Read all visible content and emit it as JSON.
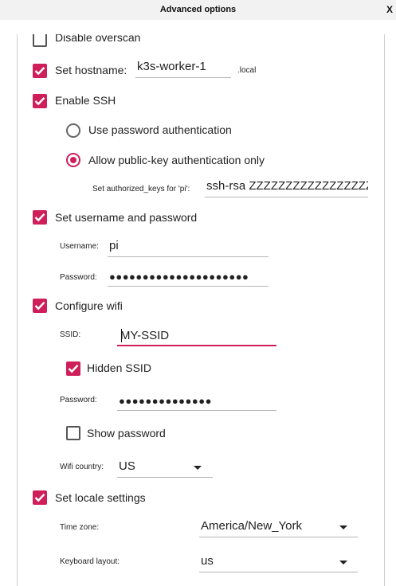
{
  "window": {
    "title": "Advanced options",
    "close_label": "X"
  },
  "colors": {
    "accent": "#cf1f5a"
  },
  "options": {
    "disable_overscan": {
      "label": "Disable overscan",
      "checked": false
    },
    "hostname": {
      "label": "Set hostname:",
      "value": "k3s-worker-1",
      "suffix": ".local",
      "checked": true
    },
    "ssh": {
      "label": "Enable SSH",
      "checked": true,
      "password_auth_label": "Use password authentication",
      "pubkey_auth_label": "Allow public-key authentication only",
      "selected": "pubkey",
      "authorized_keys_label": "Set authorized_keys for 'pi':",
      "authorized_keys_value": "ssh-rsa ZZZZZZZZZZZZZZZZZZZZ"
    },
    "user": {
      "label": "Set username and password",
      "checked": true,
      "username_label": "Username:",
      "username_value": "pi",
      "password_label": "Password:",
      "password_value": "●●●●●●●●●●●●●●●●●●●●●"
    },
    "wifi": {
      "label": "Configure wifi",
      "checked": true,
      "ssid_label": "SSID:",
      "ssid_value": "MY-SSID",
      "hidden_ssid_label": "Hidden SSID",
      "hidden_ssid_checked": true,
      "password_label": "Password:",
      "password_value": "●●●●●●●●●●●●●●",
      "show_password_label": "Show password",
      "show_password_checked": false,
      "country_label": "Wifi country:",
      "country_value": "US"
    },
    "locale": {
      "label": "Set locale settings",
      "checked": true,
      "timezone_label": "Time zone:",
      "timezone_value": "America/New_York",
      "keyboard_label": "Keyboard layout:",
      "keyboard_value": "us"
    }
  }
}
